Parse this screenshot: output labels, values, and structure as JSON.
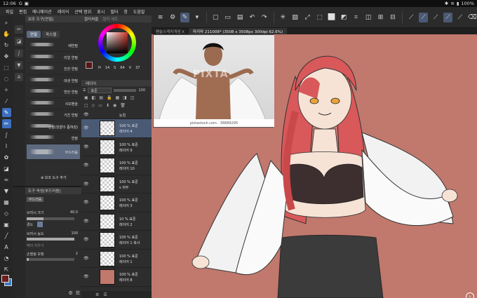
{
  "status_bar": {
    "time": "12:06",
    "icons": [
      "G-icon",
      "gallery-icon",
      "dot"
    ],
    "battery": "100%"
  },
  "menu": {
    "items": [
      "파일",
      "편집",
      "애니메이션",
      "레이어",
      "선택 범위",
      "표시",
      "필터",
      "창",
      "도움말"
    ]
  },
  "subtool_panel": {
    "title": "보조 도구[연필]",
    "tabs": [
      "연필",
      "파스텔"
    ],
    "brushes": [
      "배연필",
      "리얼 연필",
      "진한 연필",
      "데생 연필",
      "연한 연필",
      "샤프펜슬",
      "거친 연필",
      "연필(양끝이 좁혀짐)",
      "연필",
      "부드러움"
    ],
    "active_brush": "부드러움",
    "add_label": "보조 도구 추가"
  },
  "property_panel": {
    "title": "도구 속성[부드러움]",
    "preset": "부드러움",
    "rows": [
      {
        "label": "브러시 크기",
        "value": "40.0",
        "level": 0.35
      },
      {
        "label": "경도",
        "value": "",
        "level": 0.5
      },
      {
        "label": "브러시 농도",
        "value": "100",
        "level": 1.0
      },
      {
        "label": "벡터 지우기",
        "value": "",
        "level": 0
      },
      {
        "label": "손떨림 보정",
        "value": "2",
        "level": 0.05
      }
    ]
  },
  "color_panel": {
    "tabs": [
      "컬러써클",
      "컬러 세트"
    ],
    "hsv": [
      "14",
      "64",
      "37"
    ],
    "hsv_labels": [
      "H",
      "S",
      "V"
    ],
    "current_color": "#5b1414"
  },
  "layer_panel": {
    "title": "레이어",
    "blend": "표준",
    "opacity": "100",
    "layers": [
      {
        "name": "",
        "sub": "눈임",
        "eye": true,
        "filled": false,
        "active": false
      },
      {
        "name": "100 % 표준",
        "sub": "레이어 4",
        "eye": true,
        "filled": false,
        "active": true
      },
      {
        "name": "100 % 표준",
        "sub": "레이어 9",
        "eye": true,
        "filled": false,
        "active": false
      },
      {
        "name": "100 % 표준",
        "sub": "레이어 10",
        "eye": true,
        "filled": false,
        "active": false
      },
      {
        "name": "100 % 표준",
        "sub": "s 뒤부",
        "eye": true,
        "filled": false,
        "active": false
      },
      {
        "name": "100 % 표준",
        "sub": "레이어 3",
        "eye": true,
        "filled": false,
        "active": false
      },
      {
        "name": "10 % 표준",
        "sub": "레이어 2",
        "eye": true,
        "filled": false,
        "active": false
      },
      {
        "name": "100 % 표준",
        "sub": "레이어 1 복사",
        "eye": true,
        "filled": false,
        "active": false
      },
      {
        "name": "100 % 표준",
        "sub": "레이어 1",
        "eye": true,
        "filled": false,
        "active": false
      },
      {
        "name": "100 % 표준",
        "sub": "레이어 8",
        "eye": true,
        "filled": true,
        "active": false
      }
    ]
  },
  "canvas": {
    "tabs": [
      {
        "label": "펜슬스케치개념 X",
        "active": false
      },
      {
        "label": "마키마 211008* (3508 x 3508px 300dpi 62.6%)",
        "active": true
      }
    ],
    "background": "#c1786d"
  },
  "reference": {
    "caption": "pixtastock.com - 36889295",
    "watermark": "PIXTA"
  }
}
